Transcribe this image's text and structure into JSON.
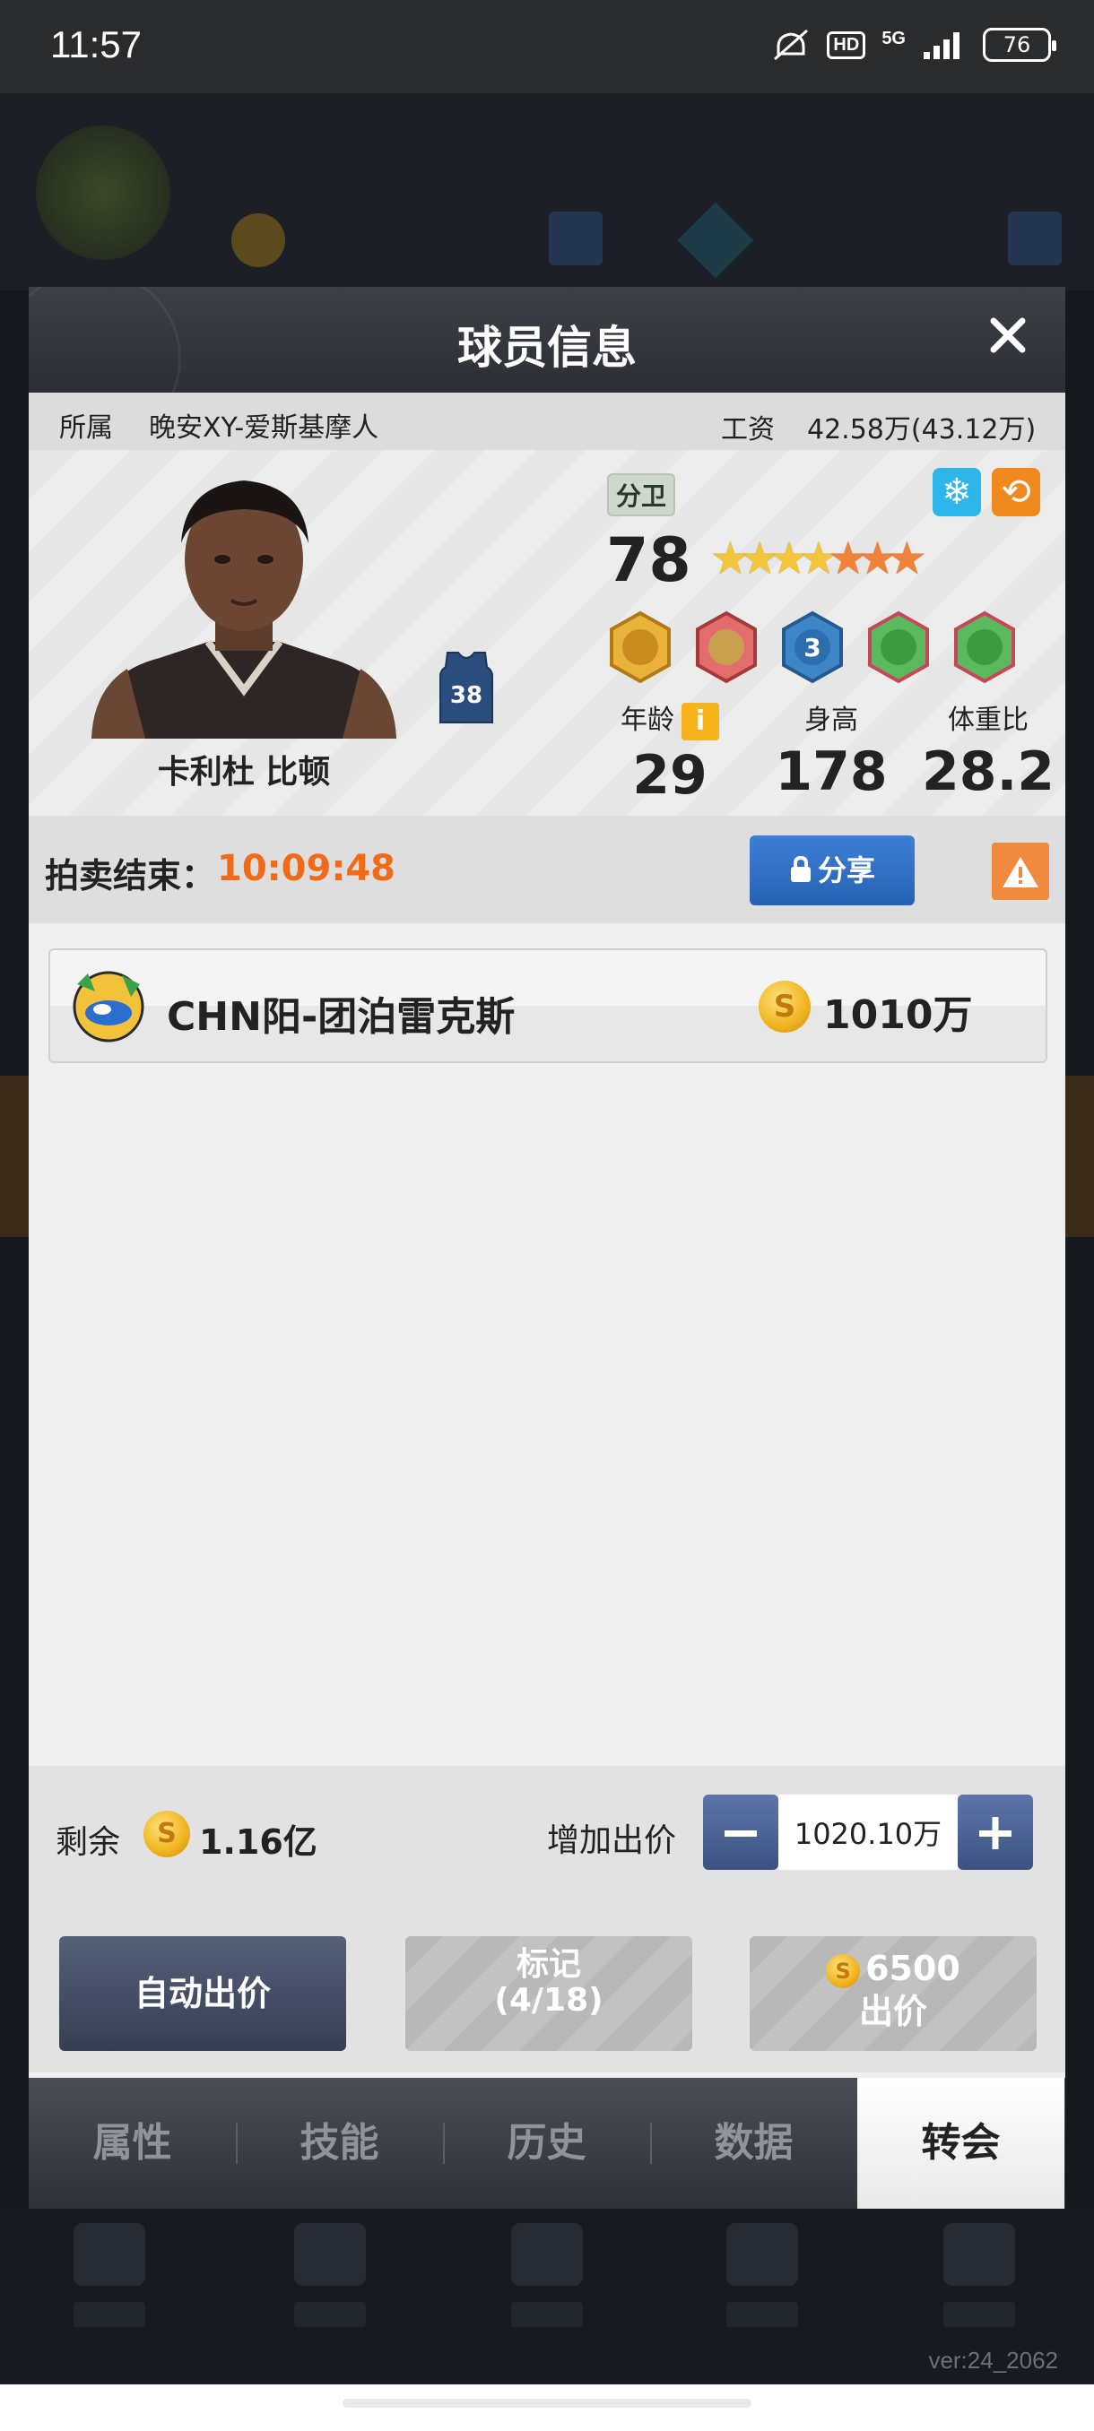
{
  "status_bar": {
    "time": "11:57",
    "network": "5G",
    "hd": "HD",
    "battery": "76"
  },
  "modal": {
    "title": "球员信息",
    "close_icon": "close-icon",
    "team_label": "所属",
    "team_name": "晚安XY-爱斯基摩人",
    "salary_label": "工资",
    "salary_value": "42.58万(43.12万)"
  },
  "player": {
    "name": "卡利杜 比顿",
    "jersey_number": "38",
    "position": "分卫",
    "rating": "78",
    "stars_gold": 4,
    "stars_orange": 3,
    "stats": [
      {
        "label": "年龄",
        "value": "29"
      },
      {
        "label": "身高",
        "value": "178"
      },
      {
        "label": "体重比",
        "value": "28.2"
      }
    ],
    "skill_icons": [
      "gold-skill-icon",
      "red-skill-icon",
      "three-point-skill-icon",
      "green-skill-icon",
      "green-skill-icon-2"
    ]
  },
  "auction": {
    "label": "拍卖结束：",
    "time_left": "10:09:48",
    "share_label": "分享",
    "bids": [
      {
        "team": "CHN阳-团泊雷克斯",
        "amount": "1010万"
      }
    ]
  },
  "controls": {
    "remain_label": "剩余",
    "remain_value": "1.16亿",
    "increase_label": "增加出价",
    "bid_amount": "1020.10万",
    "auto_bid_label": "自动出价",
    "mark_label": "标记",
    "mark_count": "(4/18)",
    "bid_cost": "6500",
    "bid_label": "出价"
  },
  "tabs": [
    {
      "label": "属性",
      "active": false
    },
    {
      "label": "技能",
      "active": false
    },
    {
      "label": "历史",
      "active": false
    },
    {
      "label": "数据",
      "active": false
    },
    {
      "label": "转会",
      "active": true
    }
  ],
  "version": "ver:24_2062",
  "colors": {
    "accent_orange": "#f06a1a",
    "share_blue": "#2662b4",
    "warning_orange": "#f08a3e"
  }
}
